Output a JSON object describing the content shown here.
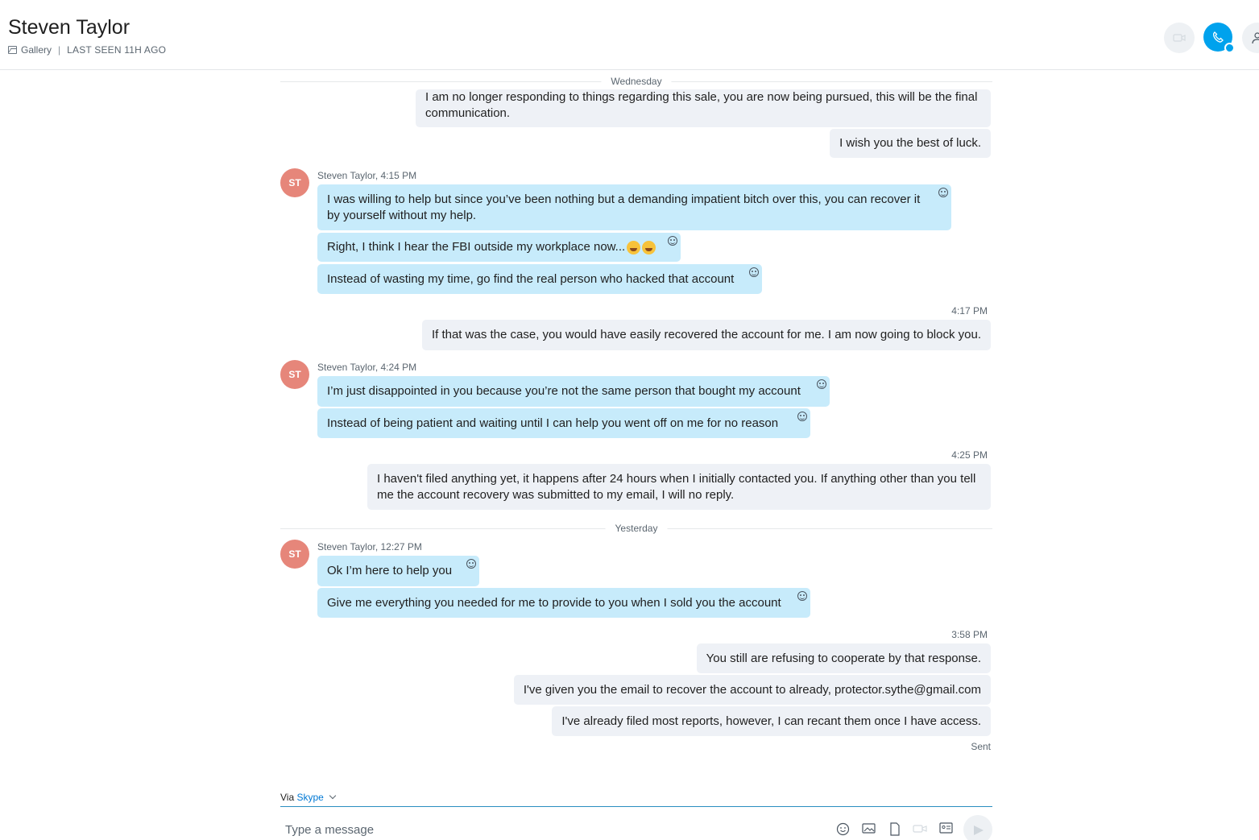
{
  "header": {
    "contact_name": "Steven Taylor",
    "gallery_label": "Gallery",
    "separator": "|",
    "last_seen": "LAST SEEN 11H AGO"
  },
  "dividers": {
    "wednesday": "Wednesday",
    "yesterday": "Yesterday"
  },
  "avatar_initials": "ST",
  "messages": {
    "out1": "I am no longer responding to things regarding this sale, you are now being pursued, this will be the final communication.",
    "out2": "I wish you the best of luck.",
    "group1_meta": "Steven Taylor, 4:15 PM",
    "in1": "I was willing to help but since you’ve been nothing but a demanding impatient bitch over this, you can recover it by yourself without my help.",
    "in2": "Right, I think I hear the FBI outside my workplace now...",
    "in3": "Instead of wasting my time, go find the real person who hacked that account",
    "time_417": "4:17 PM",
    "out3": "If that was the case, you would have easily recovered the account for me. I am now going to block you.",
    "group2_meta": "Steven Taylor, 4:24 PM",
    "in4": "I’m just disappointed in you because you’re not the same person that bought my account",
    "in5": "Instead of being patient and waiting until I can help you went off on me for no reason",
    "time_425": "4:25 PM",
    "out4": "I haven't filed anything yet, it happens after 24 hours when I initially contacted you. If anything other than you tell me the account recovery was submitted to my email, I will no reply.",
    "group3_meta": "Steven Taylor, 12:27 PM",
    "in6": "Ok I’m here to help you",
    "in7": "Give me everything you needed for me to provide to you when I sold you the account",
    "time_358": "3:58 PM",
    "out5": "You still are refusing to cooperate by that response.",
    "out6": "I've given you the email to recover the account to already, protector.sythe@gmail.com",
    "out7": "I've already filed most reports, however, I can recant them once I have access.",
    "status": "Sent"
  },
  "composer": {
    "via": "Via",
    "via_service": "Skype",
    "placeholder": "Type a message"
  },
  "icons": [
    "gallery-icon",
    "video-call-icon",
    "audio-call-icon",
    "profile-icon",
    "reaction-icon",
    "emoji-icon",
    "image-icon",
    "file-icon",
    "video-message-icon",
    "contact-card-icon",
    "send-icon"
  ],
  "colors": {
    "accent": "#00a2ed",
    "incoming_bubble": "#c7ebfb",
    "outgoing_bubble": "#eef1f6",
    "avatar": "#e6867a"
  }
}
